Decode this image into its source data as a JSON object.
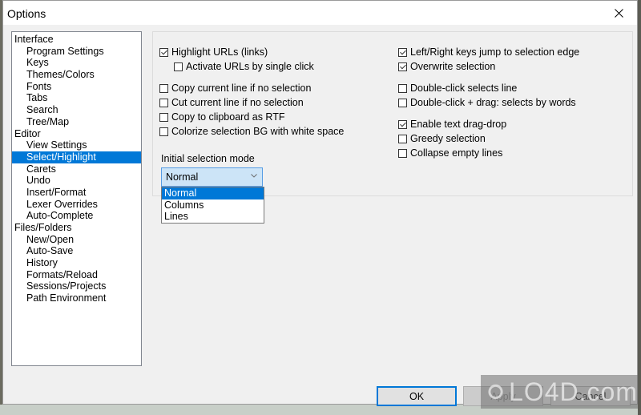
{
  "window": {
    "title": "Options",
    "close_label": "Close"
  },
  "tree": {
    "items": [
      {
        "label": "Interface",
        "level": 0
      },
      {
        "label": "Program Settings",
        "level": 1
      },
      {
        "label": "Keys",
        "level": 1
      },
      {
        "label": "Themes/Colors",
        "level": 1
      },
      {
        "label": "Fonts",
        "level": 1
      },
      {
        "label": "Tabs",
        "level": 1
      },
      {
        "label": "Search",
        "level": 1
      },
      {
        "label": "Tree/Map",
        "level": 1
      },
      {
        "label": "Editor",
        "level": 0
      },
      {
        "label": "View Settings",
        "level": 1
      },
      {
        "label": "Select/Highlight",
        "level": 1,
        "selected": true
      },
      {
        "label": "Carets",
        "level": 1
      },
      {
        "label": "Undo",
        "level": 1
      },
      {
        "label": "Insert/Format",
        "level": 1
      },
      {
        "label": "Lexer Overrides",
        "level": 1
      },
      {
        "label": "Auto-Complete",
        "level": 1
      },
      {
        "label": "Files/Folders",
        "level": 0
      },
      {
        "label": "New/Open",
        "level": 1
      },
      {
        "label": "Auto-Save",
        "level": 1
      },
      {
        "label": "History",
        "level": 1
      },
      {
        "label": "Formats/Reload",
        "level": 1
      },
      {
        "label": "Sessions/Projects",
        "level": 1
      },
      {
        "label": "Path Environment",
        "level": 1
      }
    ]
  },
  "options": {
    "left": [
      {
        "label": "Highlight URLs (links)",
        "checked": true
      },
      {
        "label": "Activate URLs by single click",
        "checked": false
      },
      {
        "label": "Copy current line if no selection",
        "checked": false
      },
      {
        "label": "Cut current line if no selection",
        "checked": false
      },
      {
        "label": "Copy to clipboard as RTF",
        "checked": false
      },
      {
        "label": "Colorize selection BG with white space",
        "checked": false
      }
    ],
    "right": [
      {
        "label": "Left/Right keys jump to selection edge",
        "checked": true
      },
      {
        "label": "Overwrite selection",
        "checked": true
      },
      {
        "label": "Double-click selects line",
        "checked": false
      },
      {
        "label": "Double-click + drag: selects by words",
        "checked": false
      },
      {
        "label": "Enable text drag-drop",
        "checked": true
      },
      {
        "label": "Greedy selection",
        "checked": false
      },
      {
        "label": "Collapse empty lines",
        "checked": false
      }
    ]
  },
  "selection_mode": {
    "label": "Initial selection mode",
    "value": "Normal",
    "options": [
      "Normal",
      "Columns",
      "Lines"
    ],
    "highlighted": "Normal"
  },
  "buttons": {
    "ok": "OK",
    "apply": "Apply",
    "cancel": "Cancel"
  },
  "watermark": {
    "text": "LO4D.com"
  },
  "colors": {
    "accent": "#0078d7",
    "combo_bg": "#cce4f7",
    "dialog_bg": "#f0f0f0"
  }
}
